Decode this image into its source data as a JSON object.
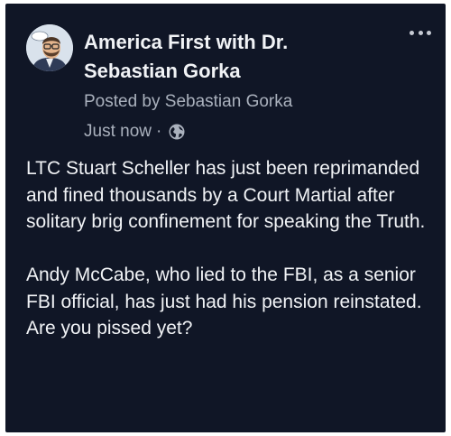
{
  "post": {
    "page_name": "America First with Dr. Sebastian Gorka",
    "posted_by": "Posted by Sebastian Gorka",
    "timestamp": "Just now",
    "separator": "·",
    "audience_icon": "globe-icon",
    "more_icon": "more-options-icon",
    "paragraphs": [
      "LTC Stuart Scheller has just been reprimanded and fined thousands by a Court Martial after solitary brig confinement for speaking the Truth.",
      "Andy McCabe, who lied to the FBI, as a senior FBI official, has just had his pension reinstated. Are you pissed yet?"
    ]
  },
  "colors": {
    "background": "#101626",
    "primary_text": "#f1f3f6",
    "secondary_text": "#aab1bd"
  }
}
